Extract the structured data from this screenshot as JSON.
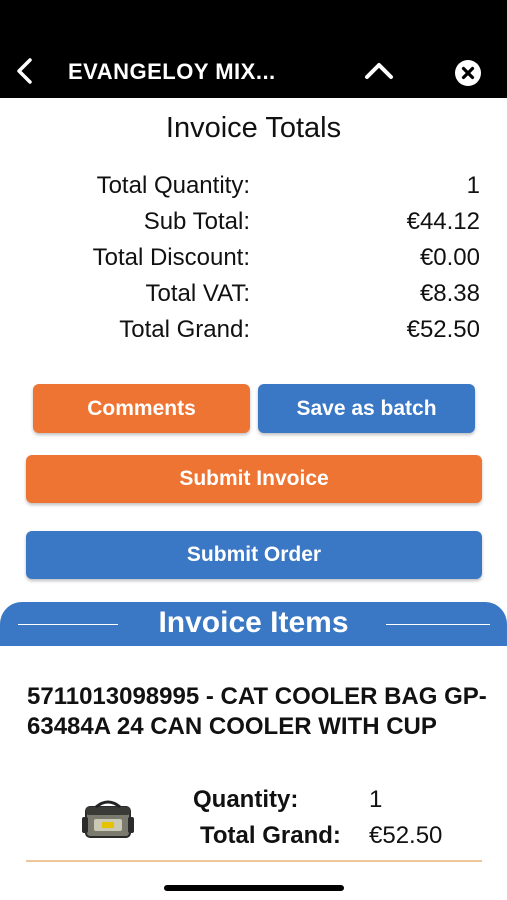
{
  "header": {
    "title": "EVANGELOY MIX...",
    "back_icon": "chevron-left-icon",
    "collapse_icon": "chevron-up-icon",
    "close_icon": "close-circle-icon"
  },
  "totals": {
    "title": "Invoice Totals",
    "rows": [
      {
        "label": "Total Quantity:",
        "value": "1"
      },
      {
        "label": "Sub Total:",
        "value": "€44.12"
      },
      {
        "label": "Total Discount:",
        "value": "€0.00"
      },
      {
        "label": "Total VAT:",
        "value": "€8.38"
      },
      {
        "label": "Total Grand:",
        "value": "€52.50"
      }
    ]
  },
  "actions": {
    "comments_label": "Comments",
    "save_batch_label": "Save as batch",
    "submit_invoice_label": "Submit Invoice",
    "submit_order_label": "Submit Order"
  },
  "items": {
    "title": "Invoice Items",
    "list": [
      {
        "description": "5711013098995 - CAT COOLER BAG GP-63484A 24 CAN COOLER WITH CUP",
        "quantity_label": "Quantity:",
        "quantity": "1",
        "total_label": "Total Grand:",
        "total": "€52.50",
        "image_icon": "cooler-bag-icon"
      }
    ]
  },
  "colors": {
    "orange": "#ee7433",
    "blue": "#3a77c4",
    "header_bg": "#000000"
  }
}
